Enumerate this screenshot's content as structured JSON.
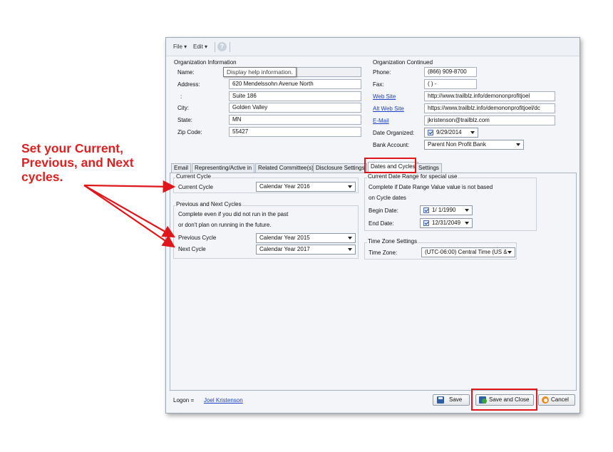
{
  "menubar": {
    "file": "File",
    "edit": "Edit"
  },
  "org_info": {
    "title": "Organization Information",
    "labels": [
      "Name:",
      "Address:",
      ":",
      "City:",
      "State:",
      "Zip Code:"
    ],
    "tooltip": "Display help information.",
    "address1": "620 Mendelssohn Avenue North",
    "address2": "Suite 186",
    "city": "Golden Valley",
    "state": "MN",
    "zip": "55427"
  },
  "org_cont": {
    "title": "Organization Continued",
    "phone_label": "Phone:",
    "phone": "(866) 909-8700",
    "fax_label": "Fax:",
    "fax": "(  )   -",
    "website_label": "Web Site",
    "website": "http://www.trailblz.info/demononprofitjoel",
    "altweb_label": "Alt Web Site",
    "altweb": "https://www.trailblz.info/demononprofitjoel/dc",
    "email_label": "E-Mail",
    "email": "jkristenson@trailblz.com",
    "date_label": "Date Organized:",
    "date": "9/29/2014",
    "bank_label": "Bank Account:",
    "bank": "Parent Non Profit Bank"
  },
  "tabs": [
    "Email",
    "Representing/Active in",
    "Related Committee(s)",
    "Disclosure Settings",
    "Dates and Cycles",
    "Settings"
  ],
  "current_cycle": {
    "title": "Current Cycle",
    "label": "Current Cycle",
    "value": "Calendar Year 2016"
  },
  "prev_next": {
    "title": "Previous and Next Cycles",
    "note1": "Complete even if you did not run in the past",
    "note2": "or don't plan on running in the future.",
    "prev_label": "Previous Cycle",
    "prev_value": "Calendar Year 2015",
    "next_label": "Next Cycle",
    "next_value": "Calendar Year 2017"
  },
  "date_range": {
    "title": "Current Date Range for special use",
    "note1": "Complete if Date Range Value value is not based",
    "note2": "on Cycle dates",
    "begin_label": "Begin Date:",
    "begin_value": "1/ 1/1990",
    "end_label": "End Date:",
    "end_value": "12/31/2049"
  },
  "timezone": {
    "title": "Time Zone Settings",
    "label": "Time Zone:",
    "value": "(UTC-06:00) Central Time (US &"
  },
  "footer": {
    "logon_label": "Logon =",
    "user": "Joel Kristenson",
    "save": "Save",
    "save_close": "Save and Close",
    "cancel": "Cancel"
  },
  "callout": {
    "line1": "Set your Current,",
    "line2": "Previous, and Next",
    "line3": "cycles."
  },
  "colors": {
    "callout": "#e02020",
    "link": "#1a3fcc"
  }
}
